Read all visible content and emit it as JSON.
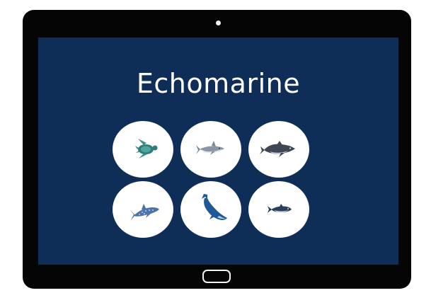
{
  "app": {
    "title": "Echomarine"
  },
  "grid": {
    "animals": [
      {
        "icon": "sea-turtle-icon"
      },
      {
        "icon": "shark-icon"
      },
      {
        "icon": "dolphin-icon"
      },
      {
        "icon": "whale-shark-icon"
      },
      {
        "icon": "humpback-whale-icon"
      },
      {
        "icon": "tuna-icon"
      }
    ]
  },
  "colors": {
    "screen_background": "#0e2d57",
    "device_frame": "#050505",
    "tile_background": "#ffffff",
    "title_text": "#ffffff"
  }
}
